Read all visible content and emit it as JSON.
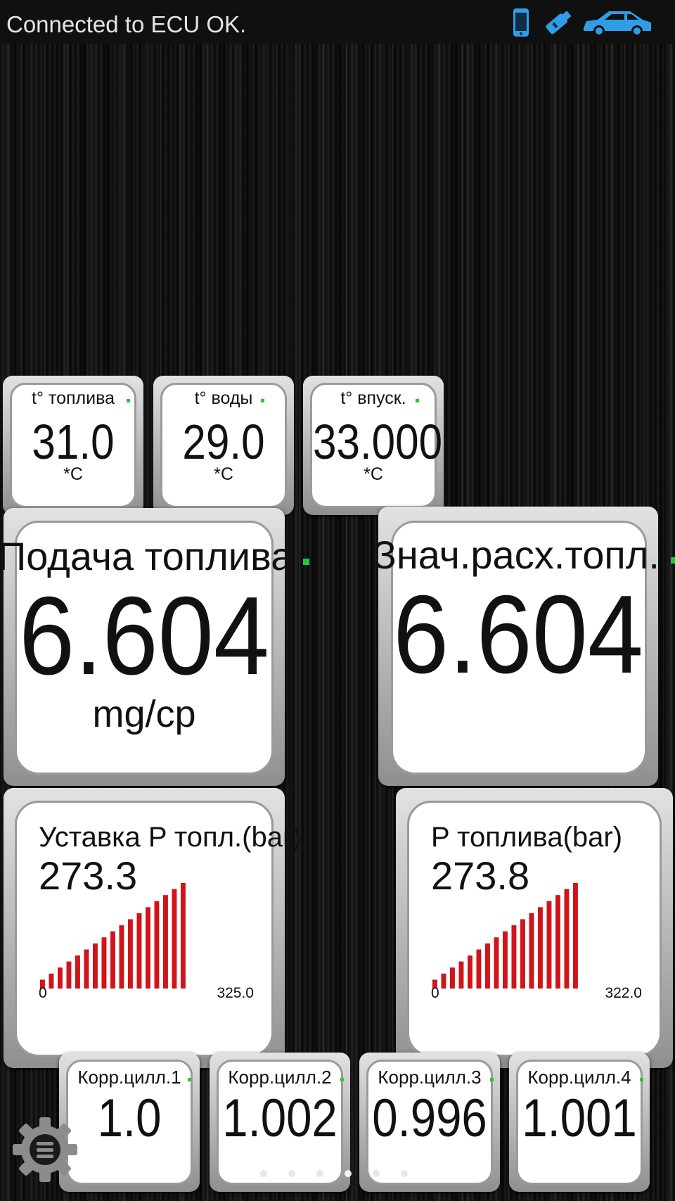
{
  "statusbar": {
    "text": "Connected to ECU OK.",
    "icons": [
      "phone-icon",
      "usb-adapter-icon",
      "car-icon"
    ],
    "icon_color": "#2f9ee8"
  },
  "small_tiles": [
    {
      "label": "t° топлива",
      "value": "31.0",
      "unit": "*C"
    },
    {
      "label": "t° воды",
      "value": "29.0",
      "unit": "*C"
    },
    {
      "label": "t° впуск.",
      "value": "33.000",
      "unit": "*C"
    }
  ],
  "big_tiles": [
    {
      "label": "Подача топлива",
      "value": "6.604",
      "unit": "mg/cp"
    },
    {
      "label": "Знач.расх.топл.",
      "value": "6.604",
      "unit": ""
    }
  ],
  "bar_tiles": [
    {
      "label": "Уставка P топл.(bar)",
      "value": "273.3",
      "min": "0",
      "max": "325.0",
      "fill": 0.84
    },
    {
      "label": "P топлива(bar)",
      "value": "273.8",
      "min": "0",
      "max": "322.0",
      "fill": 0.85
    }
  ],
  "bottom_tiles": [
    {
      "label": "Корр.цилл.1",
      "value": "1.0"
    },
    {
      "label": "Корр.цилл.2",
      "value": "1.002"
    },
    {
      "label": "Корр.цилл.3",
      "value": "0.996"
    },
    {
      "label": "Корр.цилл.4",
      "value": "1.001"
    }
  ],
  "pager": {
    "pages": 6,
    "active": 3
  },
  "colors": {
    "bar": "#d0141a",
    "live_indicator": "#1ecb3a",
    "tile_bg": "#ffffff"
  }
}
